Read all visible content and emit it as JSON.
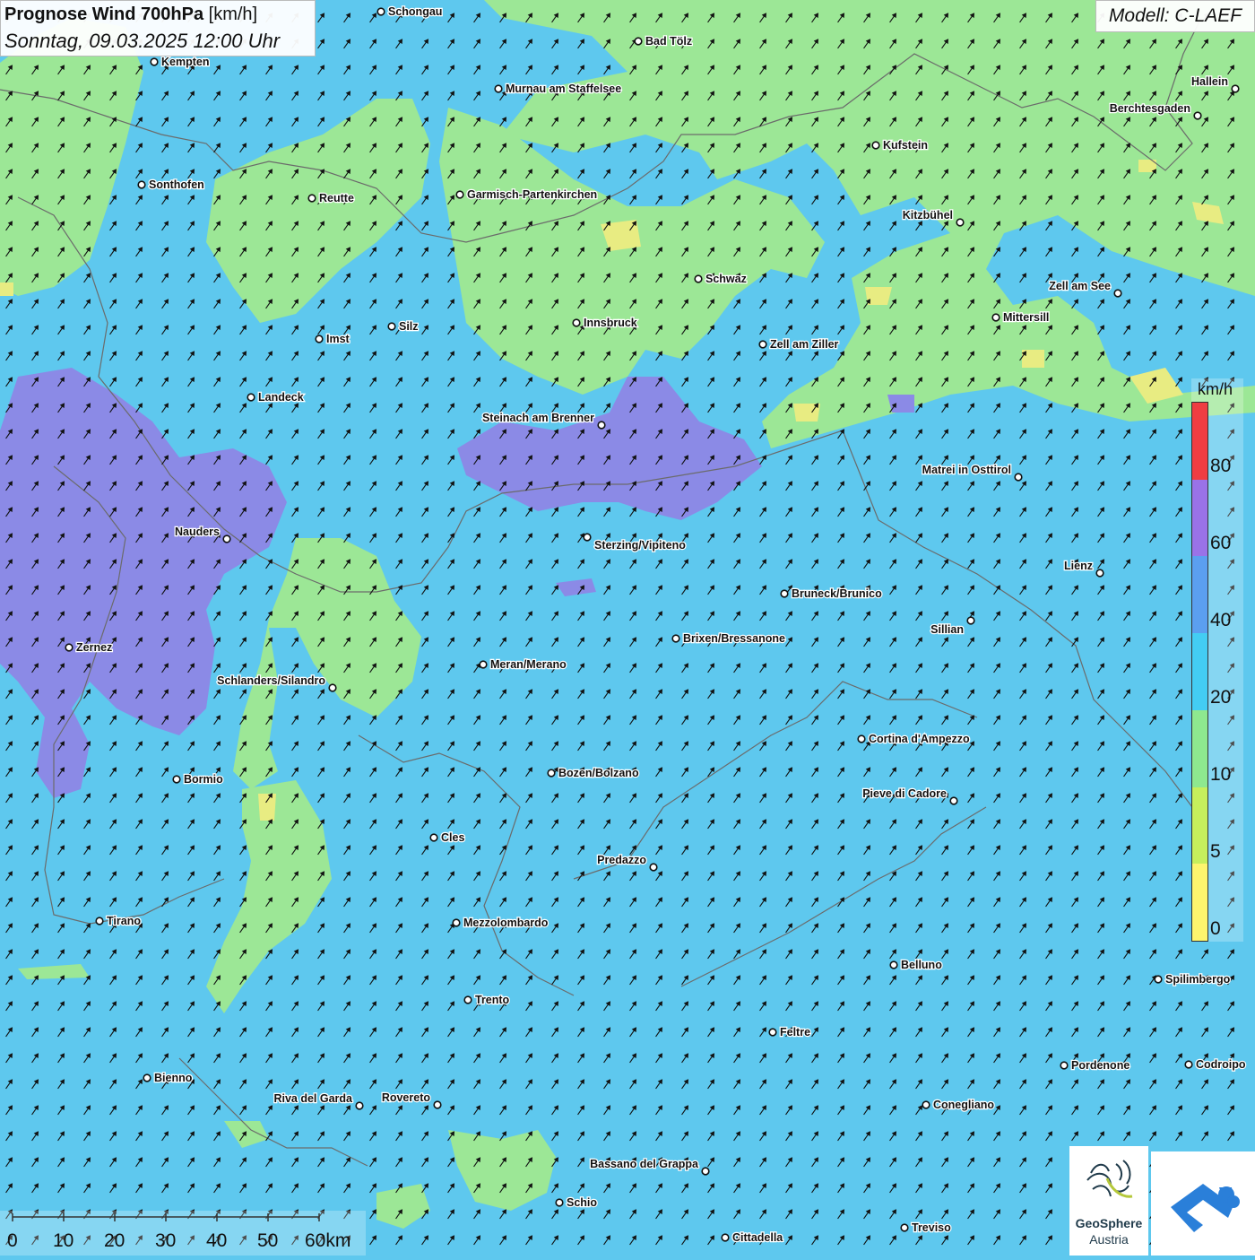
{
  "header": {
    "title_bold": "Prognose Wind 700hPa",
    "title_unit": "[km/h]",
    "date": "Sonntag, 09.03.2025 12:00 Uhr"
  },
  "model": "Modell: C-LAEF",
  "legend": {
    "unit": "km/h",
    "ticks": [
      "0",
      "5",
      "10",
      "20",
      "40",
      "60",
      "80"
    ],
    "colors": [
      "#fdf56e",
      "#c6ef5c",
      "#8ee88f",
      "#43cdf3",
      "#5b9ff0",
      "#9a72e8",
      "#ef3d42"
    ]
  },
  "field_colors": {
    "blue": "#5ec8ee",
    "green": "#9ce796",
    "purple": "#8b8ae6",
    "yellow": "#e8ec82"
  },
  "wind_arrow_direction": "toward north-east",
  "cities": [
    {
      "name": "Schongau"
    },
    {
      "name": "Kempten"
    },
    {
      "name": "Bad Tölz"
    },
    {
      "name": "Murnau am Staffelsee"
    },
    {
      "name": "Hallein"
    },
    {
      "name": "Berchtesgaden"
    },
    {
      "name": "Kufstein"
    },
    {
      "name": "Sonthofen"
    },
    {
      "name": "Reutte"
    },
    {
      "name": "Garmisch-Partenkirchen"
    },
    {
      "name": "Kitzbühel"
    },
    {
      "name": "Schwaz"
    },
    {
      "name": "Zell am See"
    },
    {
      "name": "Innsbruck"
    },
    {
      "name": "Mittersill"
    },
    {
      "name": "Imst"
    },
    {
      "name": "Silz"
    },
    {
      "name": "Zell am Ziller"
    },
    {
      "name": "Landeck"
    },
    {
      "name": "Steinach am Brenner"
    },
    {
      "name": "Matrei in Osttirol"
    },
    {
      "name": "Nauders"
    },
    {
      "name": "Sterzing/Vipiteno"
    },
    {
      "name": "Lienz"
    },
    {
      "name": "Bruneck/Brunico"
    },
    {
      "name": "Sillian"
    },
    {
      "name": "Zernez"
    },
    {
      "name": "Brixen/Bressanone"
    },
    {
      "name": "Meran/Merano"
    },
    {
      "name": "Schlanders/Silandro"
    },
    {
      "name": "Cortina d'Ampezzo"
    },
    {
      "name": "Bozen/Bolzano"
    },
    {
      "name": "Bormio"
    },
    {
      "name": "Pieve di Cadore"
    },
    {
      "name": "Cles"
    },
    {
      "name": "Predazzo"
    },
    {
      "name": "Tirano"
    },
    {
      "name": "Mezzolombardo"
    },
    {
      "name": "Belluno"
    },
    {
      "name": "Spilimbergo"
    },
    {
      "name": "Trento"
    },
    {
      "name": "Feltre"
    },
    {
      "name": "Pordenone"
    },
    {
      "name": "Codroipo"
    },
    {
      "name": "Bienno"
    },
    {
      "name": "Riva del Garda"
    },
    {
      "name": "Rovereto"
    },
    {
      "name": "Conegliano"
    },
    {
      "name": "Bassano del Grappa"
    },
    {
      "name": "Schio"
    },
    {
      "name": "Treviso"
    },
    {
      "name": "Cittadella"
    }
  ],
  "scale": {
    "labels": [
      "0",
      "10",
      "20",
      "30",
      "40",
      "50",
      "60km"
    ]
  },
  "logos": {
    "geosphere_line1": "GeoSphere",
    "geosphere_line2": "Austria"
  }
}
